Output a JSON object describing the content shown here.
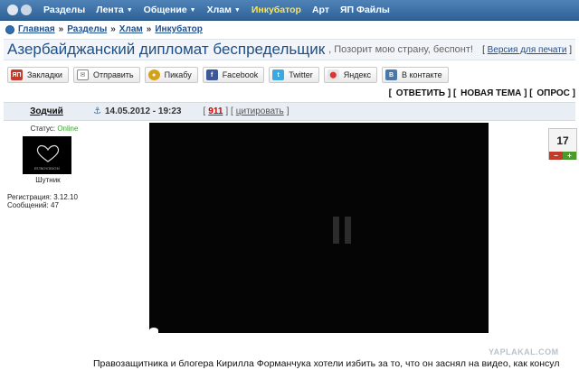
{
  "nav": {
    "items": [
      {
        "label": "Разделы",
        "caret": false,
        "highlight": false
      },
      {
        "label": "Лента",
        "caret": true,
        "highlight": false
      },
      {
        "label": "Общение",
        "caret": true,
        "highlight": false
      },
      {
        "label": "Хлам",
        "caret": true,
        "highlight": false
      },
      {
        "label": "Инкубатор",
        "caret": false,
        "highlight": true
      },
      {
        "label": "Арт",
        "caret": false,
        "highlight": false
      },
      {
        "label": "ЯП Файлы",
        "caret": false,
        "highlight": false
      }
    ]
  },
  "breadcrumb": {
    "items": [
      "Главная",
      "Разделы",
      "Хлам",
      "Инкубатор"
    ],
    "separator": "»"
  },
  "topic": {
    "title": "Азербайджанский дипломат беспредельщик",
    "subtitle": ", Позорит мою страну, беспонт!",
    "print_prefix": "[ ",
    "print_link": "Версия для печати",
    "print_suffix": " ]"
  },
  "share": [
    {
      "label": "Закладки",
      "icon": "bookmark-icon",
      "color": "#c33a2a",
      "glyph": "ЯП"
    },
    {
      "label": "Отправить",
      "icon": "mail-icon",
      "color": "#777777",
      "glyph": "✉"
    },
    {
      "label": "Пикабу",
      "icon": "pikabu-icon",
      "color": "#d4a21a",
      "glyph": "●"
    },
    {
      "label": "Facebook",
      "icon": "facebook-icon",
      "color": "#3b5998",
      "glyph": "f"
    },
    {
      "label": "Twitter",
      "icon": "twitter-icon",
      "color": "#39a9e0",
      "glyph": "t"
    },
    {
      "label": "Яндекс",
      "icon": "yandex-icon",
      "color": "#e0e0e0",
      "glyph": "⬤"
    },
    {
      "label": "В контакте",
      "icon": "vk-icon",
      "color": "#4a76a8",
      "glyph": "B"
    }
  ],
  "actions": {
    "reply": "ОТВЕТИТЬ",
    "new_topic": "НОВАЯ ТЕМА",
    "poll": "ОПРОС"
  },
  "post": {
    "author": "Зодчий",
    "date": "14.05.2012 - 19:23",
    "number": "911",
    "cite": "цитировать",
    "status_label": "Статус:",
    "status_value": "Online",
    "avatar_caption": "EUROVISION",
    "rank": "Шутник",
    "reg_label": "Регистрация:",
    "reg_value": "3.12.10",
    "msgs_label": "Сообщений:",
    "msgs_value": "47",
    "rating": "17",
    "minus": "−",
    "plus": "+",
    "text": "Правозащитника и блогера Кирилла Форманчука хотели избить за то, что он заснял на видео, как консул"
  },
  "watermark": "YAPLAKAL.COM",
  "colors": {
    "nav_bg": "#2f6398",
    "title_color": "#1d4f88",
    "highlight": "#ffe34a",
    "online": "#39a233"
  }
}
